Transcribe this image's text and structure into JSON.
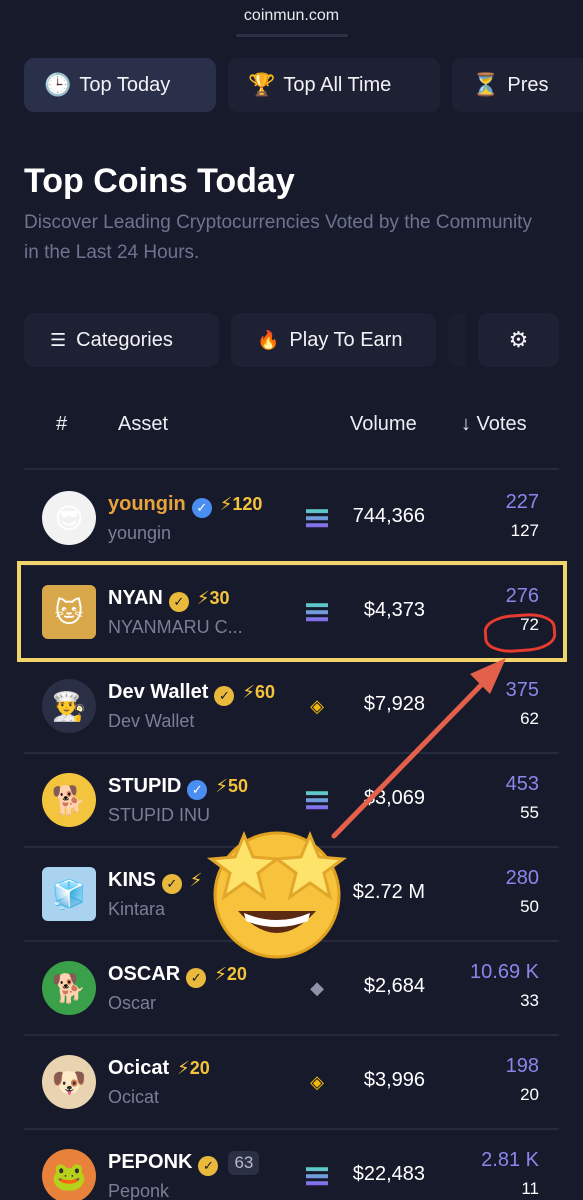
{
  "browser": {
    "url": "coinmun.com"
  },
  "tabs": [
    {
      "icon": "clock-icon",
      "glyph": "🕒",
      "label": "Top Today"
    },
    {
      "icon": "trophy-icon",
      "glyph": "🏆",
      "label": "Top All Time"
    },
    {
      "icon": "hourglass-icon",
      "glyph": "⏳",
      "label": "Pres"
    }
  ],
  "header": {
    "title": "Top Coins Today",
    "subtitle": "Discover Leading Cryptocurrencies Voted by the Community in the Last 24 Hours."
  },
  "filters": {
    "categories_label": "Categories",
    "play_label": "Play To Earn"
  },
  "table": {
    "headers": {
      "rank": "#",
      "asset": "Asset",
      "volume": "Volume",
      "votes": "↓ Votes"
    },
    "rows": [
      {
        "name": "youngin",
        "ticker": "youngin",
        "verified": "blue",
        "boost": "⚡120",
        "chain": "sol",
        "volume": "744,366",
        "votes_total": "227",
        "votes_today": "127",
        "avatar": "😎"
      },
      {
        "name": "NYAN",
        "ticker": "NYANMARU C...",
        "verified": "yellow",
        "boost": "⚡30",
        "chain": "sol",
        "volume": "$4,373",
        "votes_total": "276",
        "votes_today": "72",
        "avatar": "🐱"
      },
      {
        "name": "Dev Wallet",
        "ticker": "Dev Wallet",
        "verified": "yellow",
        "boost": "⚡60",
        "chain": "bnb",
        "volume": "$7,928",
        "votes_total": "375",
        "votes_today": "62",
        "avatar": "👨‍🍳"
      },
      {
        "name": "STUPID",
        "ticker": "STUPID INU",
        "verified": "blue",
        "boost": "⚡50",
        "chain": "sol",
        "volume": "$3,069",
        "votes_total": "453",
        "votes_today": "55",
        "avatar": "🐕"
      },
      {
        "name": "KINS",
        "ticker": "Kintara",
        "verified": "yellow",
        "boost": "⚡",
        "chain": "sol",
        "volume": "$2.72 M",
        "votes_total": "280",
        "votes_today": "50",
        "avatar": "🧊"
      },
      {
        "name": "OSCAR",
        "ticker": "Oscar",
        "verified": "yellow",
        "boost": "⚡20",
        "chain": "eth",
        "volume": "$2,684",
        "votes_total": "10.69 K",
        "votes_today": "33",
        "avatar": "🐕"
      },
      {
        "name": "Ocicat",
        "ticker": "Ocicat",
        "verified": "",
        "boost": "⚡20",
        "chain": "bnb",
        "volume": "$3,996",
        "votes_total": "198",
        "votes_today": "20",
        "avatar": "🐶"
      },
      {
        "name": "PEPONK",
        "ticker": "Peponk",
        "verified": "yellow",
        "rank_pill": "63",
        "chain": "sol",
        "volume": "$22,483",
        "votes_total": "2.81 K",
        "votes_today": "11",
        "avatar": "🐸"
      }
    ]
  },
  "overlay": {
    "emoji": "🤩"
  },
  "colors": {
    "background": "#171a2b",
    "accent_votes": "#8a86ea",
    "highlight": "#f1d46a",
    "annotation": "#e63b2e"
  }
}
